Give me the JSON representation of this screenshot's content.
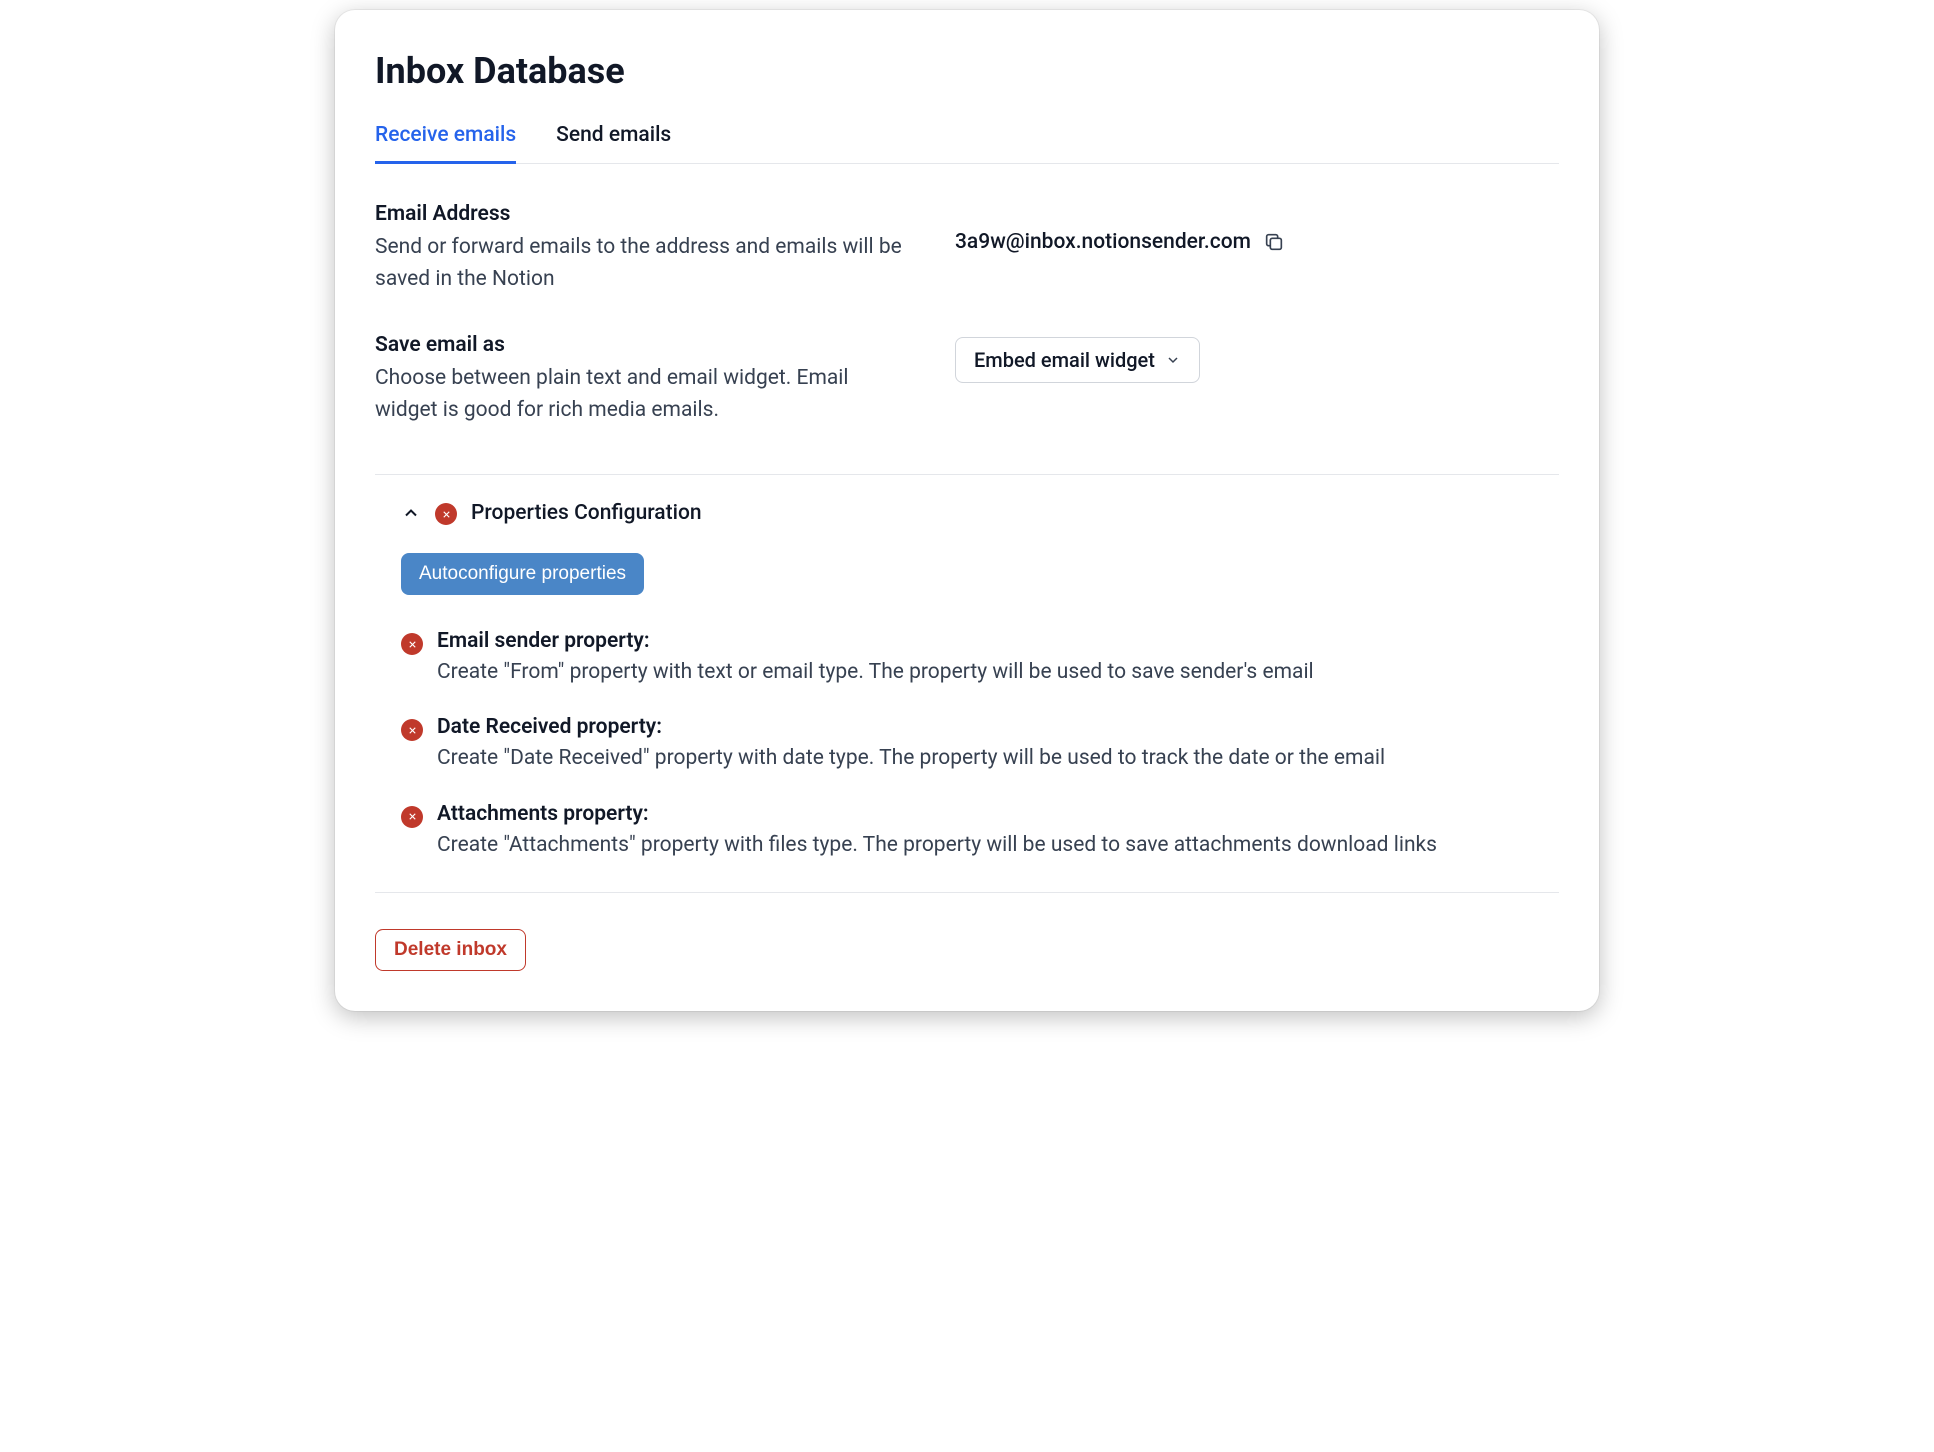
{
  "title": "Inbox Database",
  "tabs": {
    "receive": "Receive emails",
    "send": "Send emails"
  },
  "email_address": {
    "label": "Email Address",
    "description": "Send or forward emails to the address and emails will be saved in the Notion",
    "value": "3a9w@inbox.notionsender.com"
  },
  "save_as": {
    "label": "Save email as",
    "description": "Choose between plain text and email widget. Email widget is good for rich media emails.",
    "selected": "Embed email widget"
  },
  "properties": {
    "header": "Properties Configuration",
    "autoconfigure_label": "Autoconfigure properties",
    "items": [
      {
        "name": "Email sender property:",
        "desc": "Create \"From\" property with text or email type. The property will be used to save sender's email"
      },
      {
        "name": "Date Received property:",
        "desc": "Create \"Date Received\" property with date type. The property will be used to track the date or the email"
      },
      {
        "name": "Attachments property:",
        "desc": "Create \"Attachments\" property with files type. The property will be used to save attachments download links"
      }
    ]
  },
  "delete_label": "Delete inbox",
  "colors": {
    "accent": "#2563eb",
    "danger": "#c0392b",
    "primary_btn": "#4a86c7"
  }
}
